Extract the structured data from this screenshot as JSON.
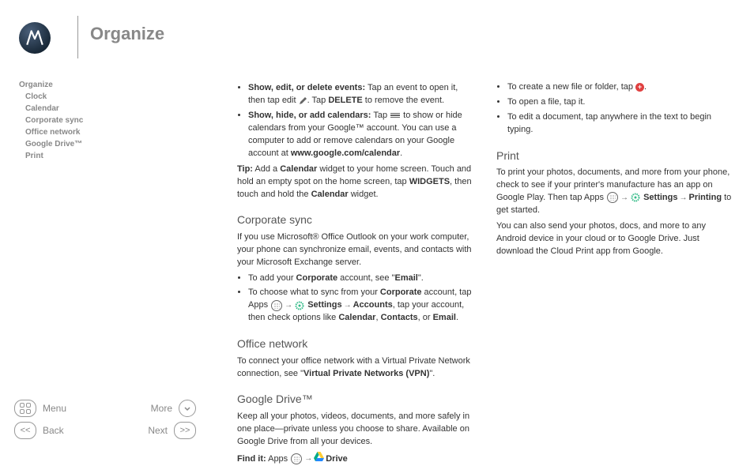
{
  "header": {
    "title": "Organize"
  },
  "toc": {
    "top": "Organize",
    "items": [
      "Clock",
      "Calendar",
      "Corporate sync",
      "Office network",
      "Google Drive™",
      "Print"
    ]
  },
  "nav": {
    "menu": "Menu",
    "more": "More",
    "back": "Back",
    "next": "Next"
  },
  "c1": {
    "b1_bold": "Show, edit, or delete events:",
    "b1_rest": " Tap an event to open it, then tap edit ",
    "b1_rest2": ". Tap ",
    "b1_delete": "DELETE",
    "b1_rest3": " to remove the event.",
    "b2_bold": "Show, hide, or add calendars:",
    "b2_rest": " Tap ",
    "b2_rest2": " to show or hide calendars from your Google™ account. You can use a computer to add or remove calendars on your Google account at ",
    "b2_url": "www.google.com/calendar",
    "b2_dot": ".",
    "tip_label": "Tip:",
    "tip_t1": " Add a ",
    "tip_cal": "Calendar",
    "tip_t2": " widget to your home screen. Touch and hold an empty spot on the home screen, tap ",
    "tip_widgets": "WIDGETS",
    "tip_t3": ", then touch and hold the ",
    "tip_t4": " widget.",
    "h_corp": "Corporate sync",
    "corp_intro": "If you use Microsoft® Office Outlook on your work computer, your phone can synchronize email, events, and contacts with your Microsoft Exchange server.",
    "corp_b1_a": "To add your ",
    "corp_b1_corp": "Corporate",
    "corp_b1_b": " account, see \"",
    "corp_b1_email": "Email",
    "corp_b1_c": "\".",
    "corp_b2_a": "To choose what to sync from your ",
    "corp_b2_b": " account, tap Apps ",
    "corp_b2_c": " ",
    "corp_b2_settings": "Settings",
    "corp_b2_d": " ",
    "corp_b2_accounts": "Accounts",
    "corp_b2_e": ", tap your account, then check options like ",
    "corp_b2_calendar": "Calendar",
    "corp_b2_f": ", ",
    "corp_b2_contacts": "Contacts",
    "corp_b2_g": ", or ",
    "corp_b2_email": "Email",
    "corp_b2_h": ".",
    "h_office": "Office network",
    "office_a": "To connect your office network with a Virtual Private Network connection, see \"",
    "office_vpn": "Virtual Private Networks (VPN)",
    "office_b": "\".",
    "h_drive": "Google Drive™",
    "drive_intro": "Keep all your photos, videos, documents, and more safely in one place—private unless you choose to share. Available on Google Drive from all your devices.",
    "findit_label": "Find it:",
    "findit_a": " Apps ",
    "findit_drive": "Drive"
  },
  "c2": {
    "b1_a": "To create a new file or folder, tap ",
    "b1_b": ".",
    "b2": "To open a file, tap it.",
    "b3": "To edit a document, tap anywhere in the text to begin typing.",
    "h_print": "Print",
    "print_a": "To print your photos, documents, and more from your phone, check to see if your printer's manufacture has an app on Google Play. Then tap Apps ",
    "print_settings": "Settings",
    "print_b": " ",
    "print_printing": "Printing",
    "print_c": " to get started.",
    "print2": "You can also send your photos, docs, and more to any Android device in your cloud or to Google Drive. Just download the Cloud Print app from Google."
  }
}
